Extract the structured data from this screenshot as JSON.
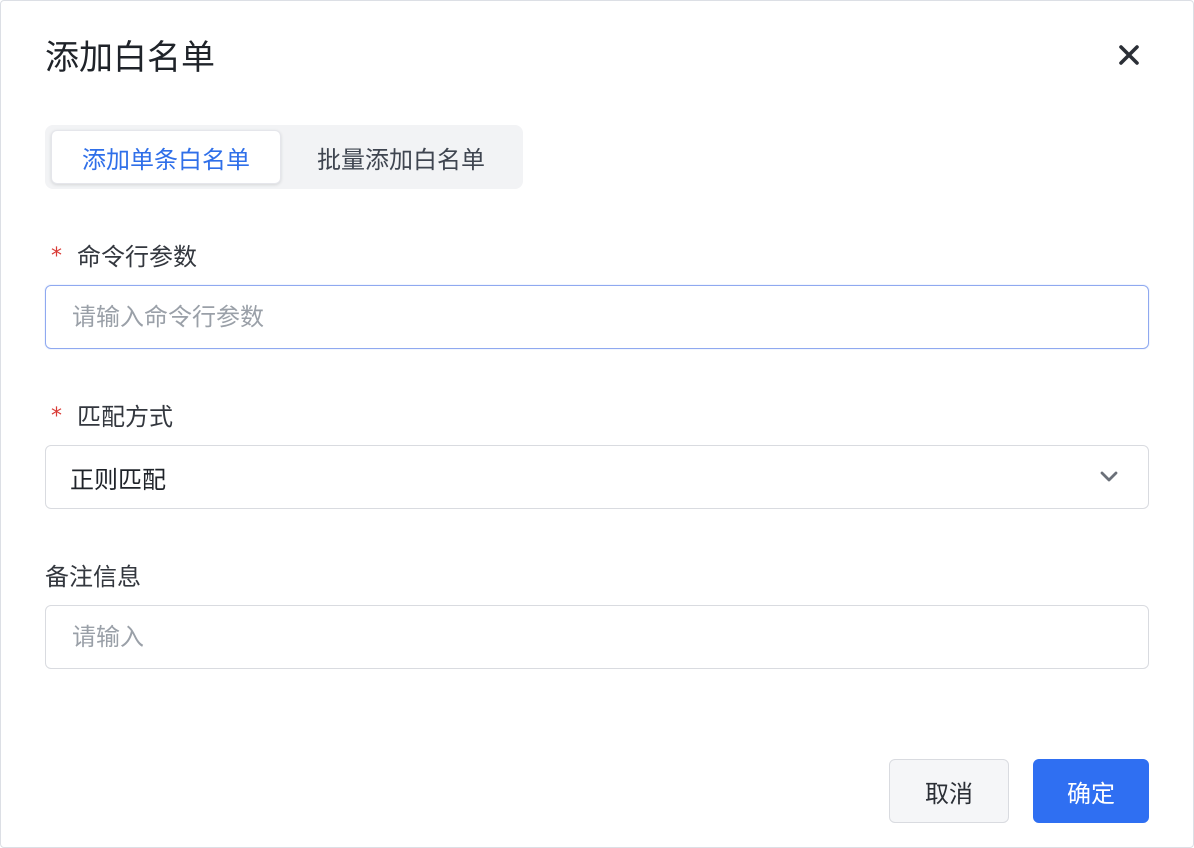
{
  "dialog": {
    "title": "添加白名单",
    "close_icon": "close-icon"
  },
  "tabs": [
    {
      "label": "添加单条白名单",
      "active": true
    },
    {
      "label": "批量添加白名单",
      "active": false
    }
  ],
  "form": {
    "command_args": {
      "label": "命令行参数",
      "required_mark": "*",
      "placeholder": "请输入命令行参数",
      "value": ""
    },
    "match_mode": {
      "label": "匹配方式",
      "required_mark": "*",
      "value": "正则匹配",
      "arrow_icon": "chevron-down-icon"
    },
    "remark": {
      "label": "备注信息",
      "placeholder": "请输入",
      "value": ""
    }
  },
  "footer": {
    "cancel_label": "取消",
    "ok_label": "确定"
  },
  "colors": {
    "primary": "#2f6ff2",
    "required": "#d93b36",
    "active_tab_text": "#2f6fe9"
  }
}
